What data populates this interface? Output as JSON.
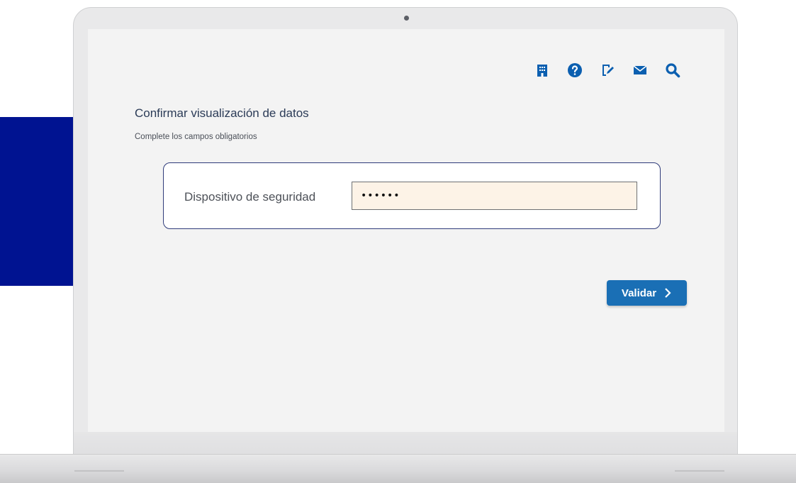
{
  "colors": {
    "accent": "#1a6fb5",
    "icon": "#0b5fb0",
    "brand_block": "#001391",
    "title": "#2b3b57",
    "input_bg": "#fdf3e7",
    "card_border": "#2f3b7a"
  },
  "toolbar": {
    "icons": [
      "building-icon",
      "help-icon",
      "edit-document-icon",
      "mail-icon",
      "search-icon"
    ]
  },
  "page": {
    "title": "Confirmar visualización de datos",
    "subtitle": "Complete los campos obligatorios"
  },
  "form": {
    "field_label": "Dispositivo de seguridad",
    "field_value": "••••••"
  },
  "actions": {
    "validate_label": "Validar"
  }
}
